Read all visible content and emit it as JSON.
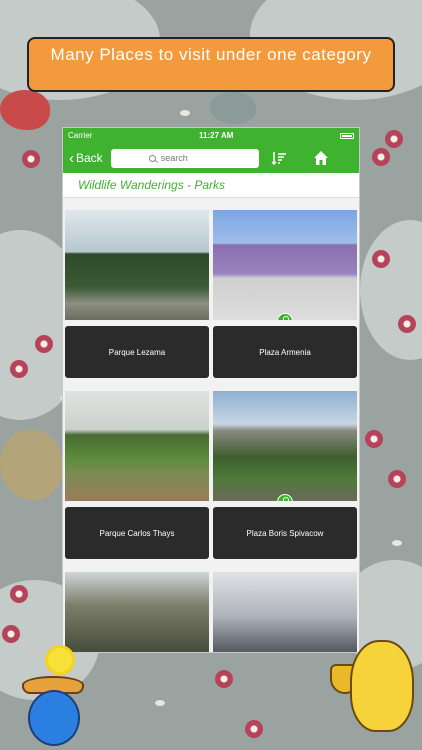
{
  "banner": {
    "text": "Many Places to visit under one category"
  },
  "status_bar": {
    "carrier": "Carrier",
    "time": "11:27 AM"
  },
  "nav": {
    "back_label": "Back",
    "search_placeholder": "search"
  },
  "page": {
    "subtitle": "Wildlife Wanderings - Parks"
  },
  "places": [
    {
      "name": "Parque Lezama",
      "locked": false
    },
    {
      "name": "Plaza Armenia",
      "locked": true
    },
    {
      "name": "Parque Carlos Thays",
      "locked": false
    },
    {
      "name": "Plaza Boris Spivacow",
      "locked": true
    },
    {
      "name": "",
      "locked": false
    },
    {
      "name": "",
      "locked": false
    }
  ],
  "colors": {
    "accent_green": "#3fb330",
    "banner_orange": "#f39a3c",
    "card_dark": "#2b2b2b"
  }
}
